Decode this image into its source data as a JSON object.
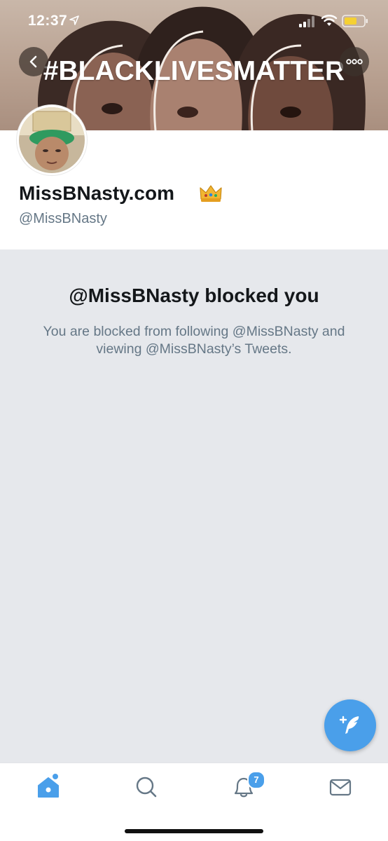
{
  "status_bar": {
    "time": "12:37",
    "icons": [
      "location-arrow-icon",
      "signal-icon",
      "wifi-icon",
      "battery-icon"
    ]
  },
  "header": {
    "banner_text": "#BLACKLIVESMATTER",
    "back_icon": "chevron-left-icon",
    "more_icon": "more-horizontal-icon"
  },
  "profile": {
    "name": "MissBNasty.com",
    "name_emoji": "crown-icon",
    "handle": "@MissBNasty"
  },
  "blocked": {
    "title": "@MissBNasty blocked you",
    "message": "You are blocked from following @MissBNasty and viewing @MissBNasty’s Tweets."
  },
  "fab": {
    "icon": "compose-tweet-icon"
  },
  "tab_bar": {
    "tabs": [
      {
        "name": "home",
        "icon": "home-icon",
        "active": true
      },
      {
        "name": "search",
        "icon": "search-icon",
        "active": false
      },
      {
        "name": "notifications",
        "icon": "bell-icon",
        "active": false,
        "badge": "7"
      },
      {
        "name": "messages",
        "icon": "envelope-icon",
        "active": false
      }
    ]
  },
  "colors": {
    "accent": "#4a9fea",
    "background": "#e6e8ec",
    "text_primary": "#14171a",
    "text_secondary": "#657786"
  }
}
